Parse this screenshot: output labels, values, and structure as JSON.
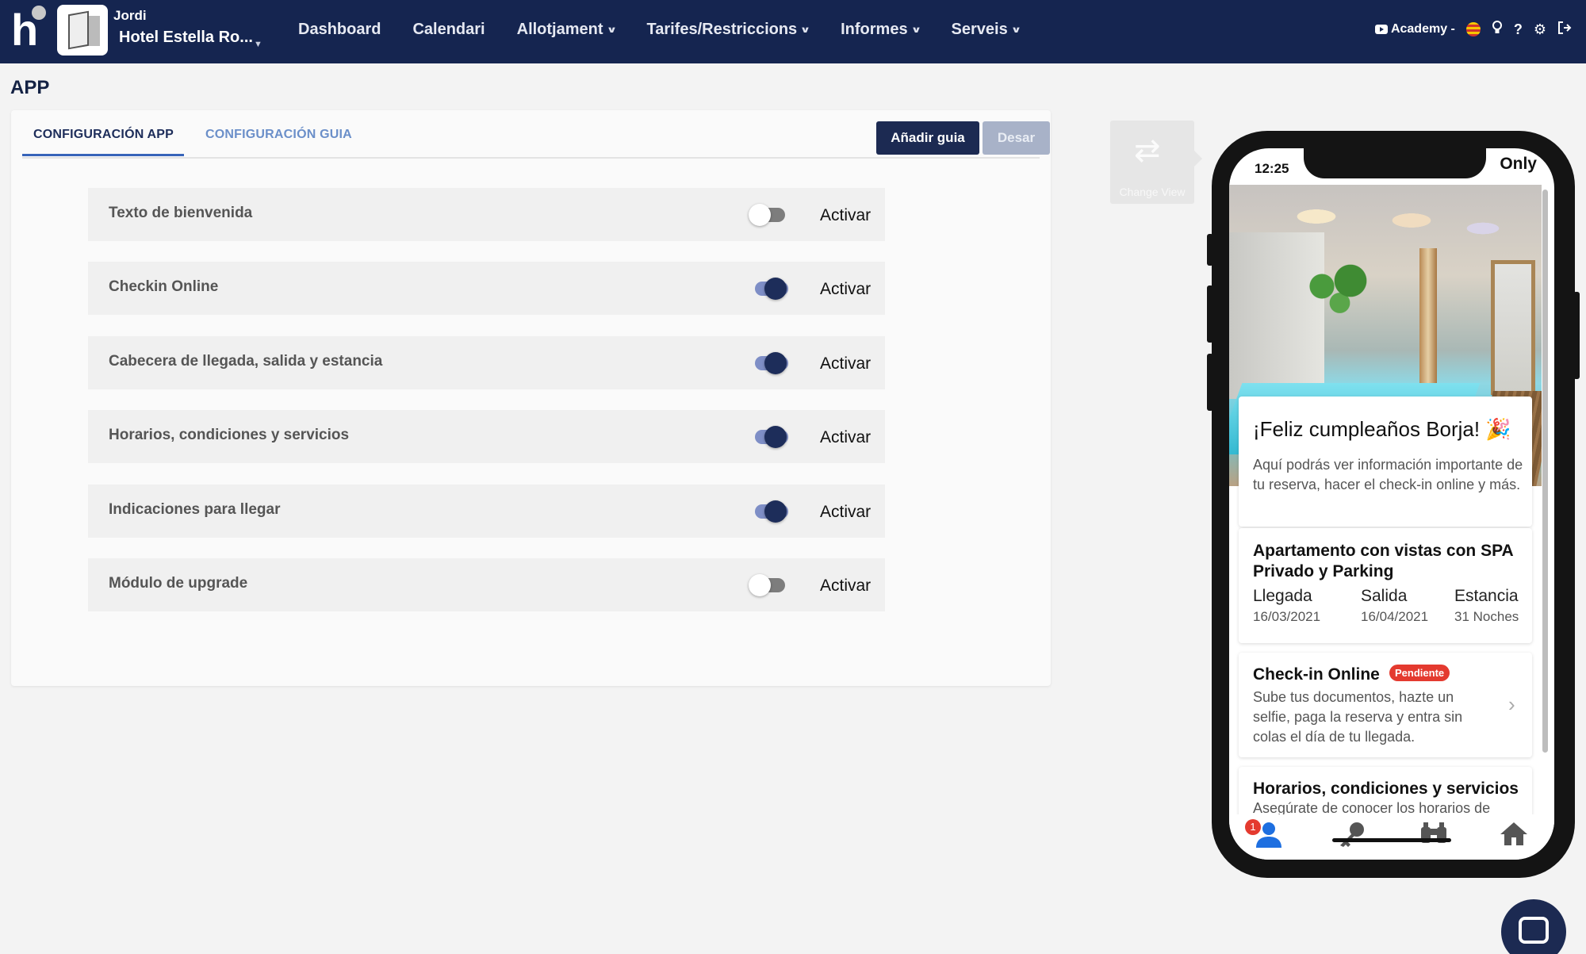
{
  "navbar": {
    "logo": "h",
    "user_name": "Jordi",
    "hotel_name": "Hotel Estella Ro...",
    "menu": [
      {
        "label": "Dashboard",
        "dropdown": false
      },
      {
        "label": "Calendari",
        "dropdown": false
      },
      {
        "label": "Allotjament",
        "dropdown": true
      },
      {
        "label": "Tarifes/Restriccions",
        "dropdown": true
      },
      {
        "label": "Informes",
        "dropdown": true
      },
      {
        "label": "Serveis",
        "dropdown": true
      }
    ],
    "academy_label": "Academy -",
    "icons": [
      "youtube-icon",
      "catalan-flag-icon",
      "lightbulb-icon",
      "help-icon",
      "gear-icon",
      "logout-icon"
    ]
  },
  "page": {
    "title": "APP"
  },
  "tabs": [
    {
      "label": "CONFIGURACIÓN APP",
      "active": true
    },
    {
      "label": "CONFIGURACIÓN GUIA",
      "active": false
    }
  ],
  "buttons": {
    "add_guide": "Añadir guia",
    "save": "Desar"
  },
  "rows": [
    {
      "label": "Texto de bienvenida",
      "enabled": false,
      "toggle_label": "Activar"
    },
    {
      "label": "Checkin Online",
      "enabled": true,
      "toggle_label": "Activar"
    },
    {
      "label": "Cabecera de llegada, salida y estancia",
      "enabled": true,
      "toggle_label": "Activar"
    },
    {
      "label": "Horarios, condiciones y servicios",
      "enabled": true,
      "toggle_label": "Activar"
    },
    {
      "label": "Indicaciones para llegar",
      "enabled": true,
      "toggle_label": "Activar"
    },
    {
      "label": "Módulo de upgrade",
      "enabled": false,
      "toggle_label": "Activar"
    }
  ],
  "change_view": {
    "label": "Change View"
  },
  "phone": {
    "time": "12:25",
    "status_right": "Only",
    "greeting": {
      "title": "¡Feliz cumpleaños Borja! 🎉",
      "text": "Aquí podrás ver información importante de tu reserva, hacer el check-in online y más."
    },
    "reservation": {
      "title": "Apartamento con vistas con SPA Privado y Parking",
      "cols": [
        {
          "label": "Llegada",
          "value": "16/03/2021"
        },
        {
          "label": "Salida",
          "value": "16/04/2021"
        },
        {
          "label": "Estancia",
          "value": "31 Noches"
        }
      ]
    },
    "checkin": {
      "title": "Check-in Online",
      "badge": "Pendiente",
      "text": "Sube tus documentos, hazte un selfie, paga la reserva y entra sin colas el día de tu llegada."
    },
    "schedules": {
      "title": "Horarios, condiciones y servicios",
      "text": "Asegúrate de conocer los horarios de"
    },
    "tabbar": {
      "badge": "1"
    }
  },
  "colors": {
    "navbar": "#152550",
    "accent": "#1c2a52",
    "toggle_on": "#1d2d5a",
    "badge": "#e43a2f"
  }
}
